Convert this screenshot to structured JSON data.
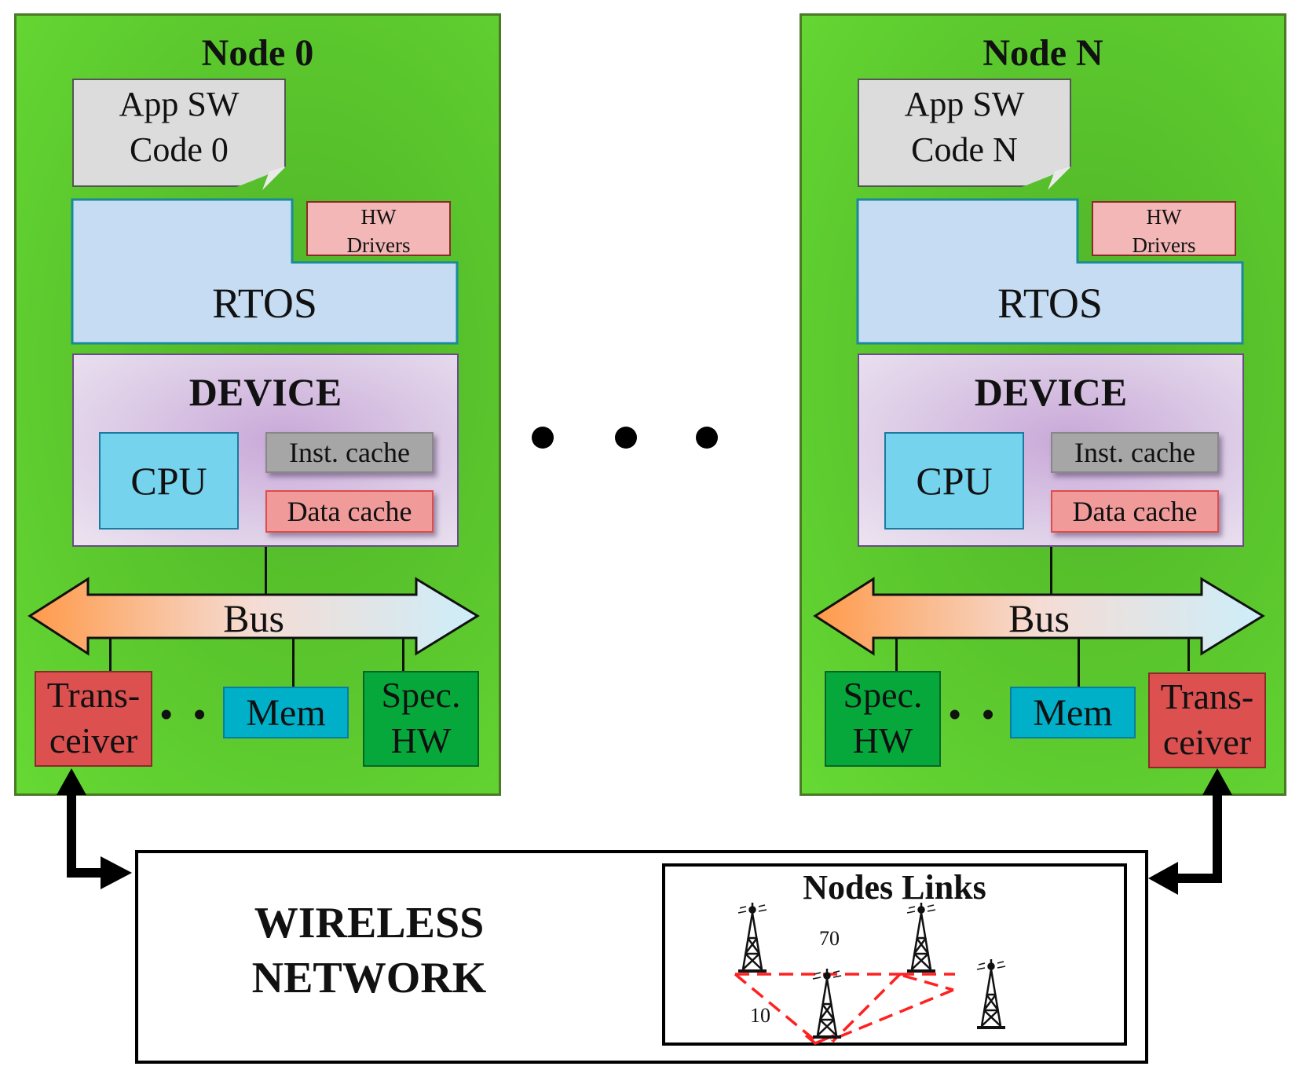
{
  "nodes": [
    {
      "title": "Node 0",
      "app_sw": {
        "line1": "App SW",
        "line2": "Code 0"
      },
      "hw_drivers": {
        "line1": "HW",
        "line2": "Drivers"
      },
      "rtos": "RTOS",
      "device": {
        "title": "DEVICE",
        "cpu": "CPU",
        "inst_cache": "Inst. cache",
        "data_cache": "Data cache"
      },
      "bus": "Bus",
      "peripherals": {
        "transceiver": {
          "line1": "Trans-",
          "line2": "ceiver"
        },
        "mem": "Mem",
        "spec_hw": {
          "line1": "Spec.",
          "line2": "HW"
        },
        "ellipsis": "• • •"
      }
    },
    {
      "title": "Node N",
      "app_sw": {
        "line1": "App SW",
        "line2": "Code N"
      },
      "hw_drivers": {
        "line1": "HW",
        "line2": "Drivers"
      },
      "rtos": "RTOS",
      "device": {
        "title": "DEVICE",
        "cpu": "CPU",
        "inst_cache": "Inst. cache",
        "data_cache": "Data cache"
      },
      "bus": "Bus",
      "peripherals": {
        "spec_hw": {
          "line1": "Spec.",
          "line2": "HW"
        },
        "mem": "Mem",
        "transceiver": {
          "line1": "Trans-",
          "line2": "ceiver"
        },
        "ellipsis": "• • •"
      }
    }
  ],
  "wireless_network": {
    "line1": "WIRELESS",
    "line2": "NETWORK",
    "nodes_links": {
      "title": "Nodes Links",
      "link_labels": [
        "70",
        "10"
      ],
      "tower_icon": "radio-tower-icon",
      "tower_count": 4
    }
  },
  "colors": {
    "node_bg": "#5cc92e",
    "app_sw_bg": "#dcdcdc",
    "rtos_bg": "#c5dcf2",
    "hw_drivers_bg": "#f4b7b7",
    "device_bg": "#dccbe6",
    "cpu_bg": "#76d3ee",
    "inst_cache_bg": "#a6a6a6",
    "data_cache_bg": "#f19a9a",
    "transceiver_bg": "#dc5050",
    "mem_bg": "#00b0c8",
    "spec_hw_bg": "#06a83c",
    "link_color": "#ff2020"
  }
}
